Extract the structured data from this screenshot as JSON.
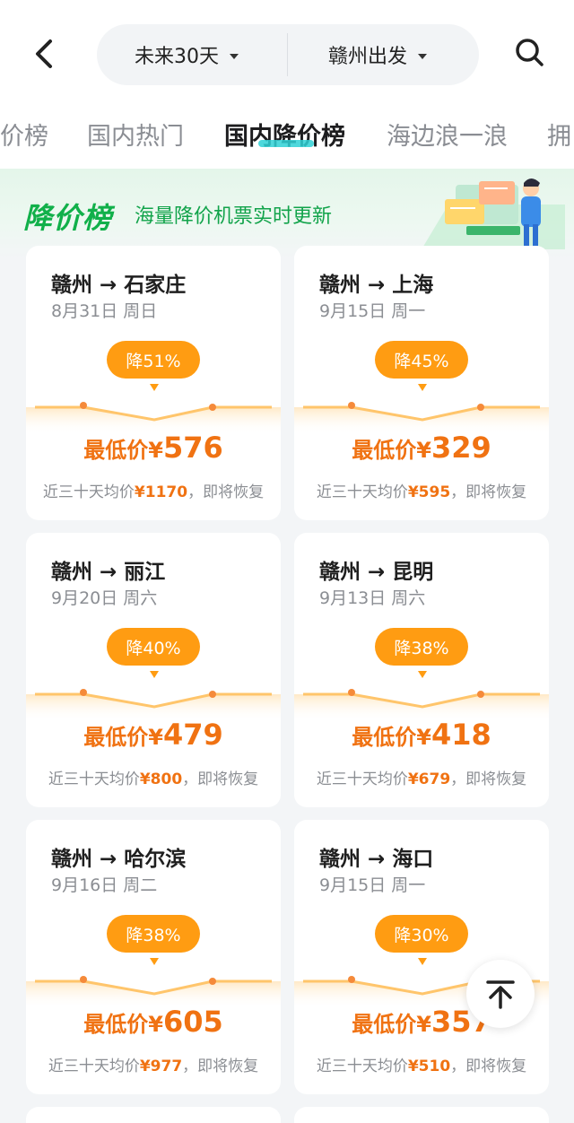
{
  "header": {
    "time_filter": "未来30天",
    "origin_filter": "赣州出发"
  },
  "tabs": [
    {
      "label": "价榜",
      "active": false
    },
    {
      "label": "国内热门",
      "active": false
    },
    {
      "label": "国内降价榜",
      "active": true
    },
    {
      "label": "海边浪一浪",
      "active": false
    },
    {
      "label": "拥",
      "active": false
    }
  ],
  "banner": {
    "title": "降价榜",
    "subtitle": "海量降价机票实时更新"
  },
  "price_label": "最低价¥",
  "avg_prefix": "近三十天均价",
  "avg_suffix": "，即将恢复",
  "cards": [
    {
      "route": "赣州 → 石家庄",
      "date": "8月31日 周日",
      "drop": "降51%",
      "price": "576",
      "avg": "¥1170"
    },
    {
      "route": "赣州 → 上海",
      "date": "9月15日 周一",
      "drop": "降45%",
      "price": "329",
      "avg": "¥595"
    },
    {
      "route": "赣州 → 丽江",
      "date": "9月20日 周六",
      "drop": "降40%",
      "price": "479",
      "avg": "¥800"
    },
    {
      "route": "赣州 → 昆明",
      "date": "9月13日 周六",
      "drop": "降38%",
      "price": "418",
      "avg": "¥679"
    },
    {
      "route": "赣州 → 哈尔滨",
      "date": "9月16日 周二",
      "drop": "降38%",
      "price": "605",
      "avg": "¥977"
    },
    {
      "route": "赣州 → 海口",
      "date": "9月15日 周一",
      "drop": "降30%",
      "price": "357",
      "avg": "¥510"
    }
  ],
  "colors": {
    "accent_orange": "#f07212",
    "badge_orange": "#ff9c12",
    "brand_green": "#11b04a"
  }
}
